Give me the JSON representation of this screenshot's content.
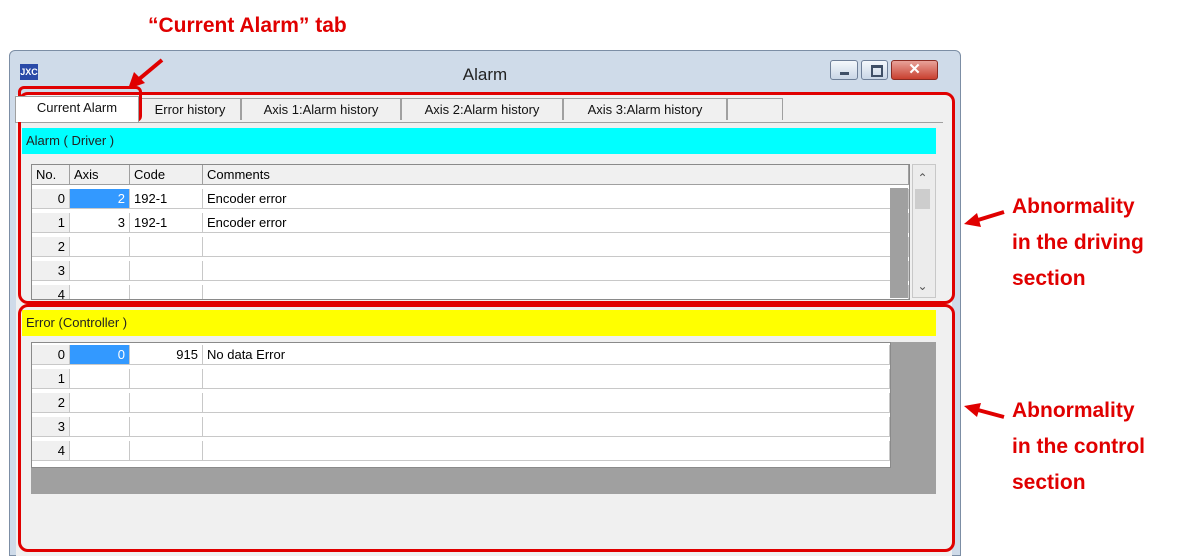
{
  "annotations": {
    "tab_callout": "“Current Alarm” tab",
    "driving_line1": "Abnormality",
    "driving_line2": "in the driving",
    "driving_line3": "section",
    "control_line1": "Abnormality",
    "control_line2": "in the control",
    "control_line3": "section"
  },
  "window": {
    "icon_text": "JXC",
    "title": "Alarm"
  },
  "tabs": [
    {
      "label": "Current Alarm",
      "active": true
    },
    {
      "label": "Error history"
    },
    {
      "label": "Axis 1:Alarm history"
    },
    {
      "label": "Axis 2:Alarm history"
    },
    {
      "label": "Axis 3:Alarm history"
    }
  ],
  "driver_section": {
    "title": "Alarm ( Driver )",
    "color": "#00ffff",
    "columns": [
      "No.",
      "Axis",
      "Code",
      "Comments"
    ],
    "rows": [
      {
        "no": "0",
        "axis": "2",
        "code": "192-1",
        "comment": "Encoder error"
      },
      {
        "no": "1",
        "axis": "3",
        "code": "192-1",
        "comment": "Encoder error"
      },
      {
        "no": "2",
        "axis": "",
        "code": "",
        "comment": ""
      },
      {
        "no": "3",
        "axis": "",
        "code": "",
        "comment": ""
      },
      {
        "no": "4",
        "axis": "",
        "code": "",
        "comment": ""
      }
    ]
  },
  "controller_section": {
    "title": "Error (Controller )",
    "color": "#ffff00",
    "rows": [
      {
        "no": "0",
        "axis": "0",
        "code": "915",
        "comment": "No data Error"
      },
      {
        "no": "1",
        "axis": "",
        "code": "",
        "comment": ""
      },
      {
        "no": "2",
        "axis": "",
        "code": "",
        "comment": ""
      },
      {
        "no": "3",
        "axis": "",
        "code": "",
        "comment": ""
      },
      {
        "no": "4",
        "axis": "",
        "code": "",
        "comment": ""
      }
    ]
  },
  "colors": {
    "annotation": "#e00000",
    "selection": "#3399ff"
  }
}
